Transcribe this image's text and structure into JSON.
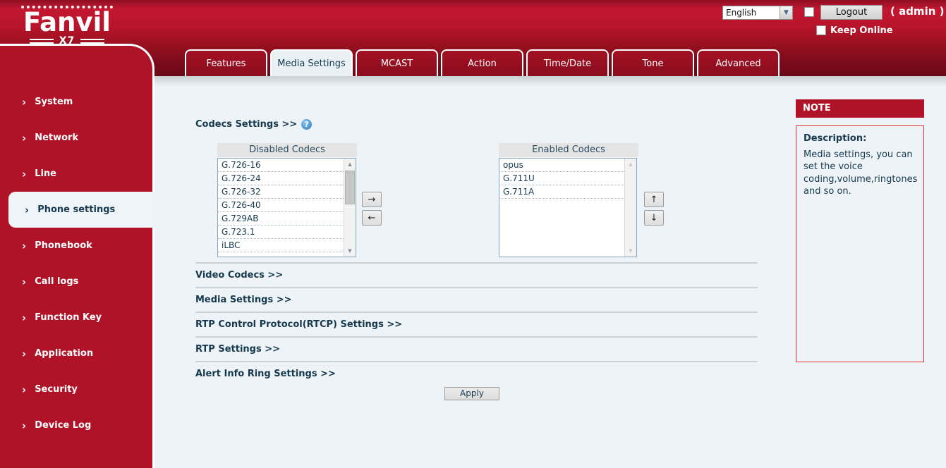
{
  "header": {
    "logo_brand": "Fanvil",
    "logo_model": "X7",
    "language": {
      "value": "English"
    },
    "logout_label": "Logout",
    "admin_label": "( admin )",
    "keep_online_label": "Keep Online"
  },
  "tabs": [
    {
      "label": "Features",
      "active": false
    },
    {
      "label": "Media Settings",
      "active": true
    },
    {
      "label": "MCAST",
      "active": false
    },
    {
      "label": "Action",
      "active": false
    },
    {
      "label": "Time/Date",
      "active": false
    },
    {
      "label": "Tone",
      "active": false
    },
    {
      "label": "Advanced",
      "active": false
    }
  ],
  "sidebar": {
    "items": [
      {
        "label": "System",
        "active": false
      },
      {
        "label": "Network",
        "active": false
      },
      {
        "label": "Line",
        "active": false
      },
      {
        "label": "Phone settings",
        "active": true
      },
      {
        "label": "Phonebook",
        "active": false
      },
      {
        "label": "Call logs",
        "active": false
      },
      {
        "label": "Function Key",
        "active": false
      },
      {
        "label": "Application",
        "active": false
      },
      {
        "label": "Security",
        "active": false
      },
      {
        "label": "Device Log",
        "active": false
      }
    ]
  },
  "main": {
    "codecs": {
      "title": "Codecs Settings >>",
      "help_icon_glyph": "?",
      "disabled_header": "Disabled Codecs",
      "disabled_items": [
        "G.726-16",
        "G.726-24",
        "G.726-32",
        "G.726-40",
        "G.729AB",
        "G.723.1",
        "iLBC"
      ],
      "enabled_header": "Enabled Codecs",
      "enabled_items": [
        "opus",
        "G.711U",
        "G.711A"
      ],
      "move_right_glyph": "→",
      "move_left_glyph": "←",
      "move_up_glyph": "↑",
      "move_down_glyph": "↓"
    },
    "sections": [
      {
        "label": "Video Codecs >>"
      },
      {
        "label": "Media Settings >>"
      },
      {
        "label": "RTP Control Protocol(RTCP) Settings >>"
      },
      {
        "label": "RTP Settings >>"
      },
      {
        "label": "Alert Info Ring Settings >>"
      }
    ],
    "apply_label": "Apply"
  },
  "note": {
    "title": "NOTE",
    "description_label": "Description:",
    "description_text": "Media settings, you can set the voice coding,volume,ringtones and so on."
  },
  "colors": {
    "header_red": "#c31731",
    "sidebar_red": "#b01228",
    "note_red": "#b01228",
    "content_bg": "#edf3f6",
    "dark_text": "#16394e",
    "tab_active_bg": "#e9f1f5"
  }
}
